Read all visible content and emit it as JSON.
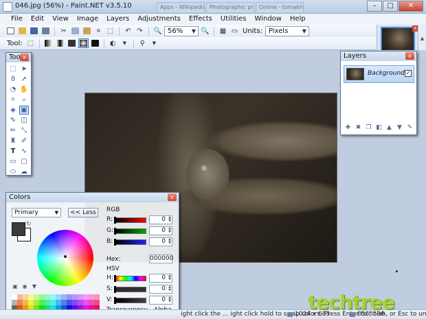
{
  "window": {
    "title": "046.jpg (56%) - Paint.NET v3.5.10",
    "background_tabs": [
      "Apps - Wikipedia, th...",
      "Photographic print...",
      "Online - tomakhub..."
    ],
    "controls": [
      "–",
      "□",
      "✕"
    ]
  },
  "menu": [
    "File",
    "Edit",
    "View",
    "Image",
    "Layers",
    "Adjustments",
    "Effects",
    "Utilities",
    "Window",
    "Help"
  ],
  "toolbar": {
    "zoom_value": "56%",
    "units_label": "Units:",
    "units_value": "Pixels"
  },
  "toolbar2": {
    "tool_label": "Tool:"
  },
  "tools_panel": {
    "title": "Tools",
    "close": "x",
    "tools": [
      "rect-select",
      "move-selection",
      "lasso",
      "move-selected",
      "zoom",
      "pan",
      "magic-wand",
      "magnify",
      "paint-bucket",
      "gradient",
      "paintbrush",
      "eraser",
      "pencil",
      "color-picker",
      "clone-stamp",
      "recolor",
      "text",
      "line-curve",
      "rectangle",
      "rounded-rectangle",
      "ellipse",
      "freeform-shape"
    ]
  },
  "layers_panel": {
    "title": "Layers",
    "close": "x",
    "layers": [
      {
        "name": "Background",
        "visible": true
      }
    ],
    "actions": [
      "add-layer",
      "delete-layer",
      "duplicate-layer",
      "merge-down",
      "move-up",
      "move-down",
      "layer-properties"
    ]
  },
  "colors_panel": {
    "title": "Colors",
    "close": "x",
    "mode": "Primary",
    "less_button": "<< Less",
    "rgb_label": "RGB",
    "hsv_label": "HSV",
    "r_label": "R:",
    "g_label": "G:",
    "b_label": "B:",
    "r_value": "0",
    "g_value": "0",
    "b_value": "0",
    "hex_label": "Hex:",
    "hex_value": "000000",
    "h_label": "H:",
    "s_label": "S:",
    "v_label": "V:",
    "h_value": "0",
    "s_value": "0",
    "v_value": "0",
    "alpha_label": "Transparency - Alpha",
    "alpha_value": "75",
    "primary_color": "#3b3b3b",
    "secondary_color": "#ffffff"
  },
  "status": {
    "hint": "ight click the ... ight click hold to swap colors. Press Enter to finish, or Esc to undo.",
    "image_size": "1024 x 683",
    "cursor_coords": "858, 596"
  },
  "watermark": "techtree"
}
